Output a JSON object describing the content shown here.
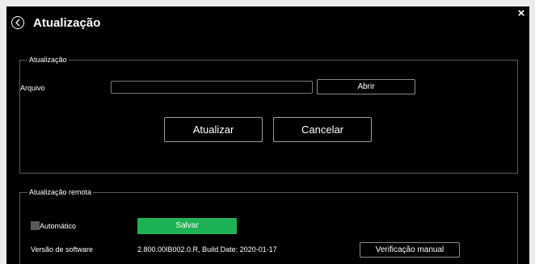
{
  "dialog": {
    "title": "Atualização",
    "close_label": "×"
  },
  "update_section": {
    "legend": "Atualização",
    "file_label": "Arquivo",
    "file_value": "",
    "open_label": "Abrir",
    "update_label": "Atualizar",
    "cancel_label": "Cancelar"
  },
  "remote_section": {
    "legend": "Atualização remota",
    "auto_label": "Automático",
    "auto_checked": false,
    "save_label": "Salvar",
    "software_version_label": "Versão de software",
    "software_version_value": "2.800.00IB002.0.R, Build Date: 2020-01-17",
    "manual_check_label": "Verificação manual"
  },
  "colors": {
    "dialog_bg": "#000000",
    "page_bg": "#ececec",
    "save_button": "#1db254",
    "checkbox": "#595959"
  },
  "icons": {
    "back": "chevron-left-circle-icon",
    "close": "close-icon"
  }
}
